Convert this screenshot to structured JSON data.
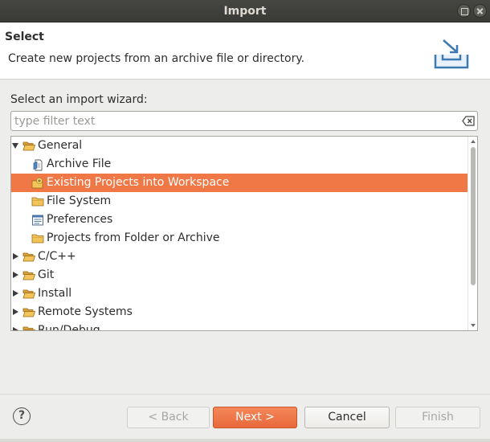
{
  "window": {
    "title": "Import"
  },
  "header": {
    "title": "Select",
    "description": "Create new projects from an archive file or directory.",
    "banner_icon": "import-wizard-banner-icon"
  },
  "body": {
    "prompt": "Select an import wizard:",
    "filter": {
      "placeholder": "type filter text",
      "value": ""
    }
  },
  "tree": {
    "items": [
      {
        "label": "General",
        "level": 0,
        "state": "expanded",
        "icon": "folder-open-icon"
      },
      {
        "label": "Archive File",
        "level": 1,
        "icon": "archive-file-icon"
      },
      {
        "label": "Existing Projects into Workspace",
        "level": 1,
        "icon": "existing-projects-icon",
        "selected": true
      },
      {
        "label": "File System",
        "level": 1,
        "icon": "folder-icon"
      },
      {
        "label": "Preferences",
        "level": 1,
        "icon": "preferences-icon"
      },
      {
        "label": "Projects from Folder or Archive",
        "level": 1,
        "icon": "folder-icon"
      },
      {
        "label": "C/C++",
        "level": 0,
        "state": "collapsed",
        "icon": "folder-open-icon"
      },
      {
        "label": "Git",
        "level": 0,
        "state": "collapsed",
        "icon": "folder-open-icon"
      },
      {
        "label": "Install",
        "level": 0,
        "state": "collapsed",
        "icon": "folder-open-icon"
      },
      {
        "label": "Remote Systems",
        "level": 0,
        "state": "collapsed",
        "icon": "folder-open-icon"
      },
      {
        "label": "Run/Debug",
        "level": 0,
        "state": "collapsed",
        "icon": "folder-open-icon"
      }
    ]
  },
  "footer": {
    "help_label": "?",
    "back_label": "< Back",
    "next_label": "Next >",
    "cancel_label": "Cancel",
    "finish_label": "Finish"
  },
  "colors": {
    "accent": "#f07746",
    "titlebar": "#3f3f3b"
  }
}
